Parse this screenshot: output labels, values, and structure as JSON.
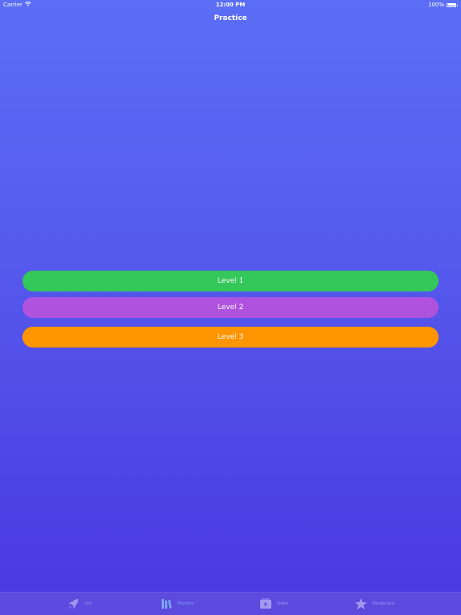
{
  "status_bar": {
    "carrier": "Carrier",
    "time": "12:00 PM",
    "battery": "100%"
  },
  "nav": {
    "title": "Practice"
  },
  "levels": [
    {
      "label": "Level 1",
      "color": "#34c759"
    },
    {
      "label": "Level 2",
      "color": "#af52de"
    },
    {
      "label": "Level 3",
      "color": "#ff9500"
    }
  ],
  "tabs": [
    {
      "label": "List",
      "icon": "rocket-icon"
    },
    {
      "label": "Practice",
      "icon": "books-icon",
      "active": true
    },
    {
      "label": "Video",
      "icon": "video-icon"
    },
    {
      "label": "Vocabulary",
      "icon": "star-icon"
    }
  ]
}
